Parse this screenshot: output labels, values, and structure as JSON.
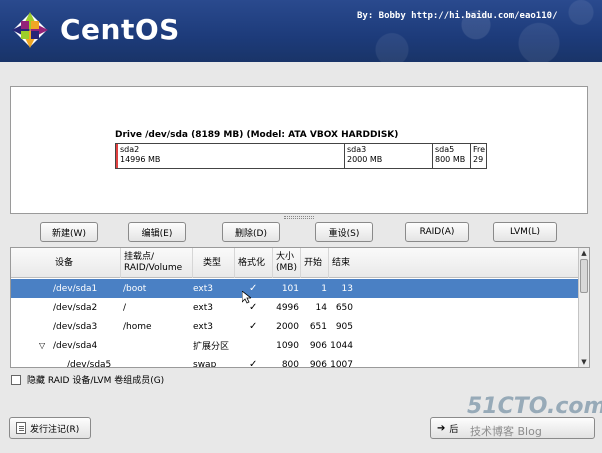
{
  "header": {
    "logo_text": "CentOS",
    "watermark": "By: Bobby http://hi.baidu.com/eao110/"
  },
  "drive": {
    "title": "Drive /dev/sda (8189 MB) (Model: ATA VBOX HARDDISK)",
    "segments": [
      {
        "name": "sda2",
        "size": "14996 MB"
      },
      {
        "name": "sda3",
        "size": "2000 MB"
      },
      {
        "name": "sda5",
        "size": "800 MB"
      },
      {
        "name": "Fre",
        "size": "29"
      }
    ]
  },
  "buttons": {
    "new": "新建(W)",
    "edit": "编辑(E)",
    "delete": "删除(D)",
    "reset": "重设(S)",
    "raid": "RAID(A)",
    "lvm": "LVM(L)"
  },
  "table": {
    "headers": {
      "device": "设备",
      "mount": "挂载点/\nRAID/Volume",
      "type": "类型",
      "format": "格式化",
      "size": "大小\n(MB)",
      "start": "开始",
      "end": "结束"
    },
    "rows": [
      {
        "device": "/dev/sda1",
        "mount": "/boot",
        "type": "ext3",
        "format": "✓",
        "size": "101",
        "start": "1",
        "end": "13"
      },
      {
        "device": "/dev/sda2",
        "mount": "/",
        "type": "ext3",
        "format": "✓",
        "size": "4996",
        "start": "14",
        "end": "650"
      },
      {
        "device": "/dev/sda3",
        "mount": "/home",
        "type": "ext3",
        "format": "✓",
        "size": "2000",
        "start": "651",
        "end": "905"
      },
      {
        "device": "/dev/sda4",
        "mount": "",
        "type": "扩展分区",
        "format": "",
        "size": "1090",
        "start": "906",
        "end": "1044"
      },
      {
        "device": "/dev/sda5",
        "mount": "",
        "type": "swap",
        "format": "✓",
        "size": "800",
        "start": "906",
        "end": "1007"
      }
    ]
  },
  "options": {
    "hide_raid": "隐藏 RAID 设备/LVM 卷组成员(G)"
  },
  "footer": {
    "release_notes": "发行注记(R)",
    "next": "后",
    "wm_51cto": "51CTO.com",
    "wm_blog": "技术博客 Blog"
  }
}
